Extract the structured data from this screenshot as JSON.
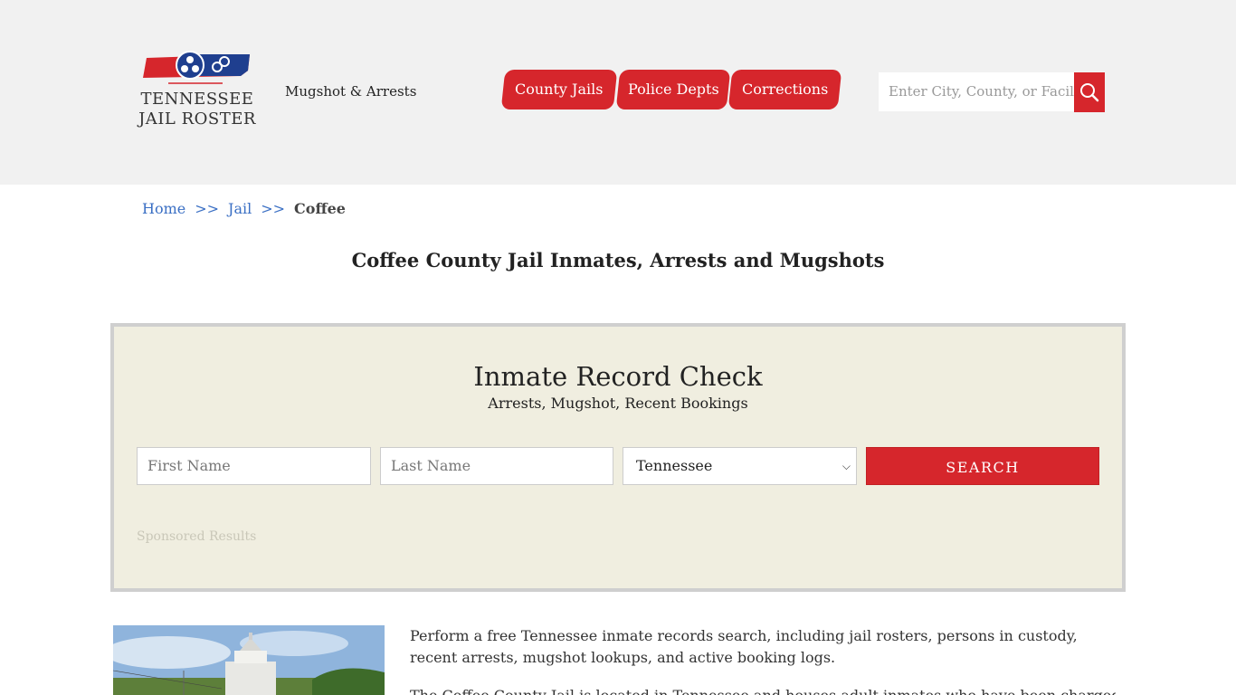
{
  "header": {
    "logo": {
      "line1": "TENNESSEE",
      "line2": "JAIL ROSTER"
    },
    "tagline": "Mugshot & Arrests",
    "nav": [
      {
        "label": "County Jails"
      },
      {
        "label": "Police Depts"
      },
      {
        "label": "Corrections"
      }
    ],
    "search": {
      "placeholder": "Enter City, County, or Facility"
    }
  },
  "breadcrumb": {
    "home": "Home",
    "sep": ">>",
    "jail": "Jail",
    "current": "Coffee"
  },
  "page_title": "Coffee County Jail Inmates, Arrests and Mugshots",
  "record_check": {
    "title": "Inmate Record Check",
    "subtitle": "Arrests, Mugshot, Recent Bookings",
    "first_name_placeholder": "First Name",
    "last_name_placeholder": "Last Name",
    "state_value": "Tennessee",
    "search_label": "SEARCH",
    "sponsored": "Sponsored Results"
  },
  "content": {
    "para1": "Perform a free Tennessee inmate records search, including jail rosters, persons in custody, recent arrests, mugshot lookups, and active booking logs.",
    "para2": "The Coffee County Jail is located in Tennessee and houses adult inmates who have been charged with"
  },
  "colors": {
    "accent": "#d6262c",
    "header_bg": "#f1f1f1",
    "panel_bg": "#f0eee0",
    "link": "#3a6fc4"
  }
}
